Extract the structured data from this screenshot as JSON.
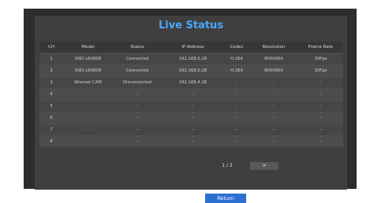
{
  "title": "Live Status",
  "columns": [
    "CH",
    "Model",
    "Status",
    "IP Address",
    "Codec",
    "Resolution",
    "Frame Rate"
  ],
  "rows": [
    {
      "ch": "1",
      "model": "XNO-L6080R",
      "status": "Connected",
      "ip": "192.168.0.28",
      "codec": "H.264",
      "resolution": "800X600",
      "frame_rate": "30Fps"
    },
    {
      "ch": "2",
      "model": "XNO-L6080R",
      "status": "Connected",
      "ip": "192.168.0.28",
      "codec": "H.264",
      "resolution": "800X600",
      "frame_rate": "30Fps"
    },
    {
      "ch": "3",
      "model": "Wisenet CAM",
      "status": "Disconnected",
      "ip": "192.168.4.28",
      "codec": "-",
      "resolution": "-",
      "frame_rate": "-"
    },
    {
      "ch": "4",
      "model": "-",
      "status": "-",
      "ip": "-",
      "codec": "-",
      "resolution": "-",
      "frame_rate": "-"
    },
    {
      "ch": "5",
      "model": "-",
      "status": "-",
      "ip": "-",
      "codec": "-",
      "resolution": "-",
      "frame_rate": "-"
    },
    {
      "ch": "6",
      "model": "-",
      "status": "-",
      "ip": "-",
      "codec": "-",
      "resolution": "-",
      "frame_rate": "-"
    },
    {
      "ch": "7",
      "model": "-",
      "status": "-",
      "ip": "-",
      "codec": "-",
      "resolution": "-",
      "frame_rate": "-"
    },
    {
      "ch": "8",
      "model": "-",
      "status": "-",
      "ip": "-",
      "codec": "-",
      "resolution": "-",
      "frame_rate": "-"
    }
  ],
  "pagination": {
    "label": "1 / 2",
    "next_label": ">"
  },
  "return_label": "Return"
}
